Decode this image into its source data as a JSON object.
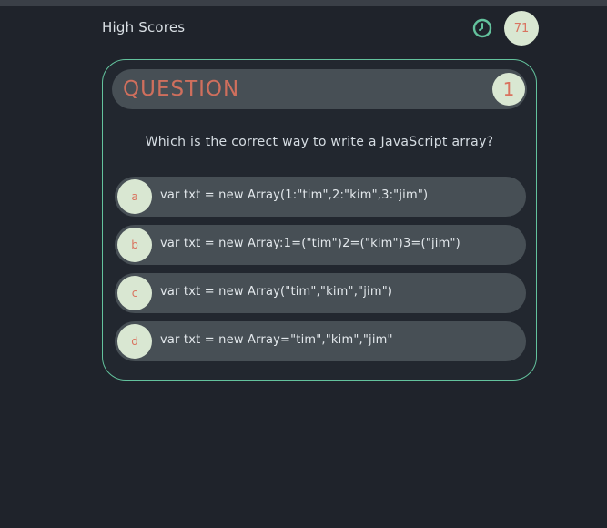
{
  "header": {
    "high_scores_label": "High Scores",
    "timer_value": "71",
    "clock_icon": "clock-icon"
  },
  "question": {
    "label": "QUESTION",
    "number": "1",
    "text": "Which is the correct way to write a JavaScript array?"
  },
  "options": [
    {
      "letter": "a",
      "text": "var txt = new Array(1:\"tim\",2:\"kim\",3:\"jim\")"
    },
    {
      "letter": "b",
      "text": "var txt = new Array:1=(\"tim\")2=(\"kim\")3=(\"jim\")"
    },
    {
      "letter": "c",
      "text": "var txt = new Array(\"tim\",\"kim\",\"jim\")"
    },
    {
      "letter": "d",
      "text": "var txt = new Array=\"tim\",\"kim\",\"jim\""
    }
  ],
  "colors": {
    "background": "#1f232b",
    "accent_green": "#63c29d",
    "accent_coral": "#cf6f5d",
    "pill_bg": "#474f55",
    "badge_bg": "#d9e7d2"
  }
}
